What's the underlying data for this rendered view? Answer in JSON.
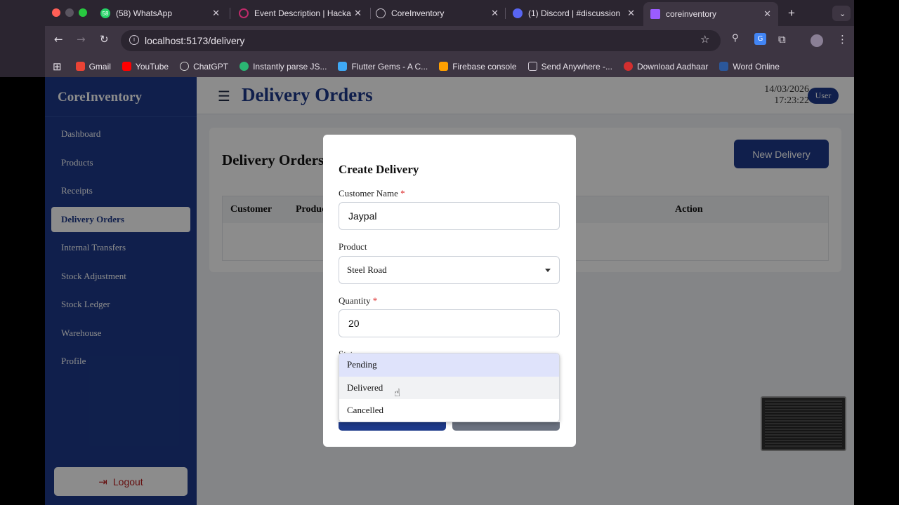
{
  "browser": {
    "tabs": [
      {
        "title": "(58) WhatsApp",
        "badge": "58",
        "color": "#25d366"
      },
      {
        "title": "Event Description | Hacka",
        "color": "#c02a6a"
      },
      {
        "title": "CoreInventory",
        "color": "#a0a0a0"
      },
      {
        "title": "(1) Discord | #discussion",
        "color": "#5865f2"
      },
      {
        "title": "coreinventory",
        "color": "#9b5cff"
      }
    ],
    "address": "localhost:5173/delivery",
    "bookmarks": [
      {
        "label": "Gmail",
        "color": "#ea4335"
      },
      {
        "label": "YouTube",
        "color": "#ff0000"
      },
      {
        "label": "ChatGPT",
        "color": "#d0d0d0"
      },
      {
        "label": "Instantly parse JS...",
        "color": "#2bb673"
      },
      {
        "label": "Flutter Gems - A C...",
        "color": "#3fa9f5"
      },
      {
        "label": "Firebase console",
        "color": "#ffa000"
      },
      {
        "label": "Send Anywhere -...",
        "color": "#333333"
      },
      {
        "label": "Download Aadhaar",
        "color": "#d32f2f"
      },
      {
        "label": "Word Online",
        "color": "#2b579a"
      }
    ]
  },
  "app": {
    "brand": "CoreInventory",
    "nav": [
      "Dashboard",
      "Products",
      "Receipts",
      "Delivery Orders",
      "Internal Transfers",
      "Stock Adjustment",
      "Stock Ledger",
      "Warehouse",
      "Profile"
    ],
    "active_nav": "Delivery Orders",
    "logout": "Logout",
    "page_title": "Delivery Orders",
    "date": "14/03/2026",
    "time": "17:23:22",
    "user": "User",
    "card_title": "Delivery Orders",
    "new_button": "New Delivery",
    "table_headers": [
      "Customer",
      "Produc",
      "Action"
    ],
    "accent": "#1e3a8a"
  },
  "modal": {
    "title": "Create Delivery",
    "customer_label": "Customer Name",
    "customer_value": "Jaypal",
    "product_label": "Product",
    "product_value": "Steel Road",
    "quantity_label": "Quantity",
    "quantity_value": "20",
    "status_label": "Stat",
    "required_mark": "*",
    "status_options": [
      "Pending",
      "Delivered",
      "Cancelled"
    ],
    "selected_option": "Pending"
  }
}
